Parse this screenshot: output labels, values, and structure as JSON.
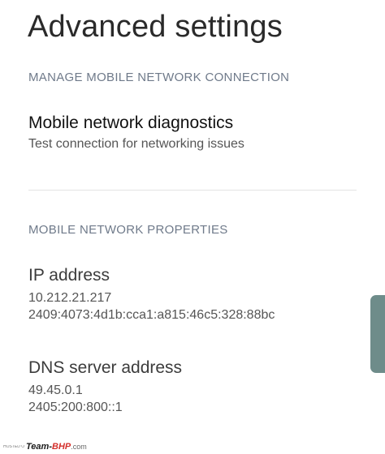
{
  "header": {
    "title": "Advanced settings"
  },
  "sections": {
    "manage": {
      "header": "MANAGE MOBILE NETWORK CONNECTION",
      "diagnostics": {
        "title": "Mobile network diagnostics",
        "subtitle": "Test connection for networking issues"
      }
    },
    "properties": {
      "header": "MOBILE NETWORK PROPERTIES",
      "ip": {
        "title": "IP address",
        "ipv4": "10.212.21.217",
        "ipv6": "2409:4073:4d1b:cca1:a815:46c5:328:88bc"
      },
      "dns": {
        "title": "DNS server address",
        "primary": "49.45.0.1",
        "secondary": "2405:200:800::1"
      }
    }
  },
  "watermark": {
    "hosted": "HOSTED ON :",
    "logo_team": "Team-",
    "logo_bhp": "BHP",
    "logo_domain": ".com"
  },
  "colors": {
    "section_header": "#6f7a8a",
    "scroll_tab": "#6e8c8a"
  }
}
